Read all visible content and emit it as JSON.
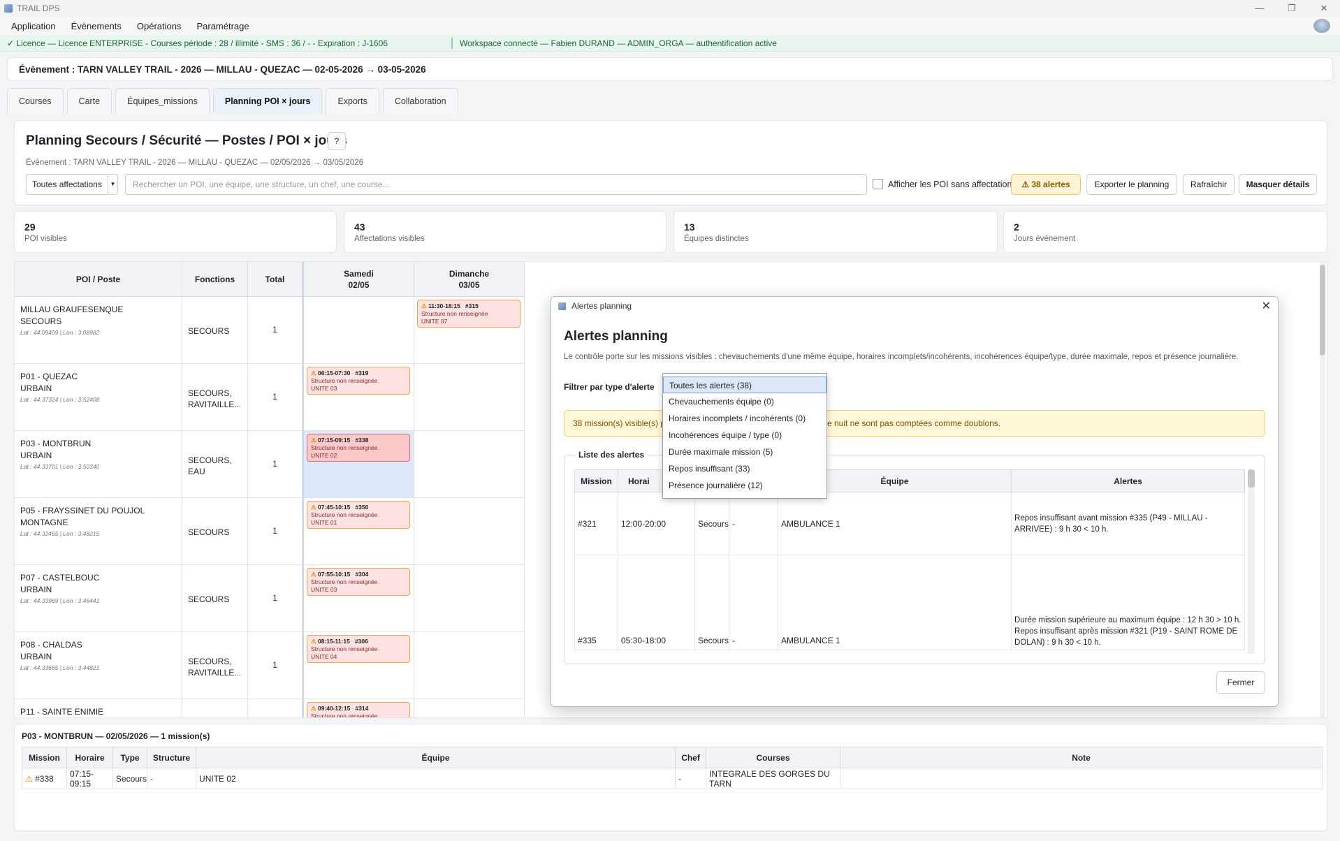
{
  "window": {
    "title": "TRAIL DPS",
    "controls": [
      "—",
      "❐",
      "✕"
    ]
  },
  "menu": [
    "Application",
    "Évènements",
    "Opérations",
    "Paramétrage"
  ],
  "license": {
    "left": "✓ Licence — Licence ENTERPRISE - Courses période : 28 / illimité - SMS : 36 / - - Expiration : J-1606",
    "right": "Workspace connecté — Fabien DURAND — ADMIN_ORGA — authentification active"
  },
  "event": {
    "label": "Évènement : TARN VALLEY TRAIL - 2026 — MILLAU - QUEZAC — 02-05-2026 → 03-05-2026"
  },
  "tabs": [
    "Courses",
    "Carte",
    "Équipes_missions",
    "Planning POI × jours",
    "Exports",
    "Collaboration"
  ],
  "planning": {
    "title": "Planning Secours / Sécurité — Postes / POI × jours",
    "help": "?",
    "subtitle": "Évènement : TARN VALLEY TRAIL - 2026 — MILLAU - QUEZAC — 02/05/2026 → 03/05/2026",
    "filter_value": "Toutes affectations",
    "search_placeholder": "Rechercher un POI, une équipe, une structure, un chef, une course...",
    "checkbox_label": "Afficher les POI sans affectation",
    "alerts_button": "38 alertes",
    "export_button": "Exporter le planning",
    "refresh_button": "Rafraîchir",
    "hide_details_button": "Masquer détails"
  },
  "stats": [
    {
      "value": "29",
      "label": "POI visibles"
    },
    {
      "value": "43",
      "label": "Affectations visibles"
    },
    {
      "value": "13",
      "label": "Équipes distinctes"
    },
    {
      "value": "2",
      "label": "Jours événement"
    }
  ],
  "grid": {
    "headers": {
      "poi": "POI / Poste",
      "fonctions": "Fonctions",
      "total": "Total",
      "day1": "Samedi\n02/05",
      "day2": "Dimanche\n03/05"
    },
    "rows": [
      {
        "name": "MILLAU GRAUFESENQUE\nSECOURS",
        "coords": "Lat : 44.09409 | Lon : 3.08982",
        "fn": "SECOURS",
        "total": "1",
        "day1": null,
        "day2": {
          "time": "11:30-18:15",
          "id": "#315",
          "line1": "Structure non renseignée",
          "line2": "UNITE 07"
        }
      },
      {
        "name": "P01 - QUEZAC\nURBAIN",
        "coords": "Lat : 44.37324 | Lon : 3.52408",
        "fn": "SECOURS,\nRAVITAILLE...",
        "total": "1",
        "day1": {
          "time": "06:15-07:30",
          "id": "#319",
          "line1": "Structure non renseignée",
          "line2": "UNITE 03"
        },
        "day2": null
      },
      {
        "name": "P03 - MONTBRUN\nURBAIN",
        "coords": "Lat : 44.33701 | Lon : 3.50340",
        "fn": "SECOURS,\nEAU",
        "total": "1",
        "day1": {
          "time": "07:15-09:15",
          "id": "#338",
          "line1": "Structure non renseignée",
          "line2": "UNITE 02"
        },
        "day2": null
      },
      {
        "name": "P05 - FRAYSSINET DU POUJOL\nMONTAGNE",
        "coords": "Lat : 44.32465 | Lon : 3.48215",
        "fn": "SECOURS",
        "total": "1",
        "day1": {
          "time": "07:45-10:15",
          "id": "#350",
          "line1": "Structure non renseignée",
          "line2": "UNITE 01"
        },
        "day2": null
      },
      {
        "name": "P07 - CASTELBOUC\nURBAIN",
        "coords": "Lat : 44.33969 | Lon : 3.46441",
        "fn": "SECOURS",
        "total": "1",
        "day1": {
          "time": "07:55-10:15",
          "id": "#304",
          "line1": "Structure non renseignée",
          "line2": "UNITE 03"
        },
        "day2": null
      },
      {
        "name": "P08 - CHALDAS\nURBAIN",
        "coords": "Lat : 44.33665 | Lon : 3.44821",
        "fn": "SECOURS,\nRAVITAILLE...",
        "total": "1",
        "day1": {
          "time": "08:15-11:15",
          "id": "#306",
          "line1": "Structure non renseignée",
          "line2": "UNITE 04"
        },
        "day2": null
      },
      {
        "name": "P11 - SAINTE ENIMIE",
        "coords": "",
        "fn": "",
        "total": "",
        "day1": {
          "time": "09:40-12:15",
          "id": "#314",
          "line1": "Structure non renseignée",
          "line2": ""
        },
        "day2": null
      }
    ]
  },
  "details": {
    "title": "P03 - MONTBRUN — 02/05/2026 — 1 mission(s)",
    "headers": [
      "Mission",
      "Horaire",
      "Type",
      "Structure",
      "Équipe",
      "Chef",
      "Courses",
      "Note"
    ],
    "row": [
      "#338",
      "07:15-09:15",
      "Secours",
      "-",
      "UNITE 02",
      "-",
      "INTEGRALE DES GORGES DU TARN",
      ""
    ]
  },
  "dialog": {
    "window_title": "Alertes planning",
    "title": "Alertes planning",
    "description": "Le contrôle porte sur les missions visibles : chevauchements d'une même équipe, horaires incomplets/incohérents, incohérences équipe/type, durée maximale, repos et présence journalière.",
    "filter_label": "Filtrer par type d'alerte",
    "warning": "38 mission(s) visible(s) présentent au moins une alerte. Les missions qui passent minuit ne sont pas comptées comme doublons.",
    "warning_left": "38 mission(s) visible(s) p",
    "warning_right": "e nuit ne sont pas comptées comme doublons.",
    "group_label": "Liste des alertes",
    "table_headers": [
      "Mission",
      "Horai",
      "",
      "",
      "Équipe",
      "Alertes"
    ],
    "table_rows": [
      {
        "mission": "#321",
        "horaire": "12:00-20:00",
        "type": "Secours",
        "structure": "-",
        "equipe": "AMBULANCE 1",
        "alerts": [
          "Repos insuffisant avant mission #335 (P49 - MILLAU - ARRIVEE) : 9 h 30 < 10 h."
        ]
      },
      {
        "mission": "#335",
        "horaire": "05:30-18:00",
        "type": "Secours",
        "structure": "-",
        "equipe": "AMBULANCE 1",
        "alerts": [
          "Durée mission supérieure au maximum équipe : 12 h 30 > 10 h.",
          "Repos insuffisant après mission #321 (P19 - SAINT ROME DE DOLAN) : 9 h 30 < 10 h."
        ]
      }
    ],
    "close_button": "Fermer",
    "filter_options": [
      "Toutes les alertes (38)",
      "Chevauchements équipe (0)",
      "Horaires incomplets / incohérents (0)",
      "Incohérences équipe / type (0)",
      "Durée maximale mission (5)",
      "Repos insuffisant (33)",
      "Présence journalière (12)"
    ],
    "selected_option": 0
  },
  "colors": {
    "accent": "#2f6fd6",
    "card_bg": "#fde2e2",
    "card_border": "#f2a44a",
    "license_green": "#136a32",
    "warning_bg": "#fff7d8"
  }
}
